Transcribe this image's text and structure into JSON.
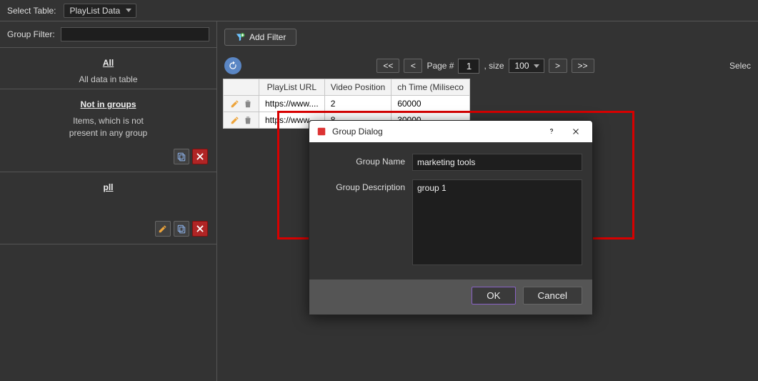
{
  "topbar": {
    "select_table_label": "Select Table:",
    "selected_table": "PlayList Data"
  },
  "sidebar": {
    "filter_label": "Group Filter:",
    "filter_value": "",
    "groups": [
      {
        "title": "All",
        "sub": "All data in table"
      },
      {
        "title": "Not in groups",
        "sub": "Items, which is not\npresent in any group"
      },
      {
        "title": "pll",
        "sub": ""
      }
    ]
  },
  "toolbar": {
    "add_filter": "Add Filter"
  },
  "pager": {
    "first": "<<",
    "prev": "<",
    "page_label": "Page #",
    "page_value": "1",
    "size_label": ", size",
    "size_value": "100",
    "next": ">",
    "last": ">>",
    "selected_text": "Selec"
  },
  "table": {
    "headers": [
      "PlayList URL",
      "Video Position",
      "ch Time (Miliseco"
    ],
    "rows": [
      [
        "https://www....",
        "2",
        "60000"
      ],
      [
        "https://www....",
        "8",
        "30000"
      ]
    ]
  },
  "dialog": {
    "title": "Group Dialog",
    "name_label": "Group Name",
    "name_value": "marketing tools",
    "desc_label": "Group Description",
    "desc_value": "group 1",
    "ok": "OK",
    "cancel": "Cancel"
  }
}
